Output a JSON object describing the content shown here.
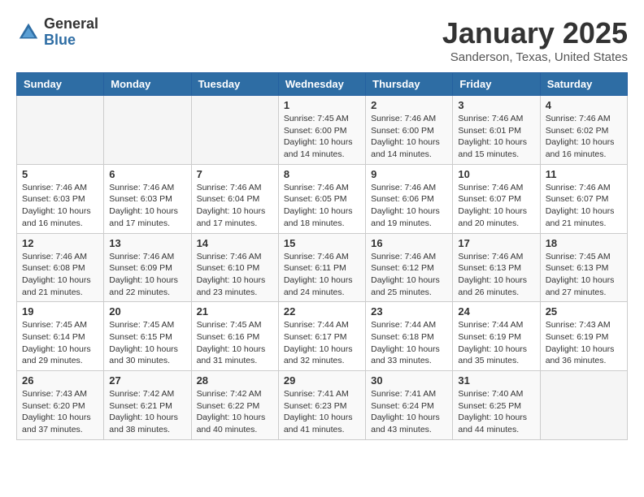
{
  "header": {
    "logo_general": "General",
    "logo_blue": "Blue",
    "title": "January 2025",
    "subtitle": "Sanderson, Texas, United States"
  },
  "days_of_week": [
    "Sunday",
    "Monday",
    "Tuesday",
    "Wednesday",
    "Thursday",
    "Friday",
    "Saturday"
  ],
  "weeks": [
    [
      {
        "day": "",
        "info": ""
      },
      {
        "day": "",
        "info": ""
      },
      {
        "day": "",
        "info": ""
      },
      {
        "day": "1",
        "info": "Sunrise: 7:45 AM\nSunset: 6:00 PM\nDaylight: 10 hours and 14 minutes."
      },
      {
        "day": "2",
        "info": "Sunrise: 7:46 AM\nSunset: 6:00 PM\nDaylight: 10 hours and 14 minutes."
      },
      {
        "day": "3",
        "info": "Sunrise: 7:46 AM\nSunset: 6:01 PM\nDaylight: 10 hours and 15 minutes."
      },
      {
        "day": "4",
        "info": "Sunrise: 7:46 AM\nSunset: 6:02 PM\nDaylight: 10 hours and 16 minutes."
      }
    ],
    [
      {
        "day": "5",
        "info": "Sunrise: 7:46 AM\nSunset: 6:03 PM\nDaylight: 10 hours and 16 minutes."
      },
      {
        "day": "6",
        "info": "Sunrise: 7:46 AM\nSunset: 6:03 PM\nDaylight: 10 hours and 17 minutes."
      },
      {
        "day": "7",
        "info": "Sunrise: 7:46 AM\nSunset: 6:04 PM\nDaylight: 10 hours and 17 minutes."
      },
      {
        "day": "8",
        "info": "Sunrise: 7:46 AM\nSunset: 6:05 PM\nDaylight: 10 hours and 18 minutes."
      },
      {
        "day": "9",
        "info": "Sunrise: 7:46 AM\nSunset: 6:06 PM\nDaylight: 10 hours and 19 minutes."
      },
      {
        "day": "10",
        "info": "Sunrise: 7:46 AM\nSunset: 6:07 PM\nDaylight: 10 hours and 20 minutes."
      },
      {
        "day": "11",
        "info": "Sunrise: 7:46 AM\nSunset: 6:07 PM\nDaylight: 10 hours and 21 minutes."
      }
    ],
    [
      {
        "day": "12",
        "info": "Sunrise: 7:46 AM\nSunset: 6:08 PM\nDaylight: 10 hours and 21 minutes."
      },
      {
        "day": "13",
        "info": "Sunrise: 7:46 AM\nSunset: 6:09 PM\nDaylight: 10 hours and 22 minutes."
      },
      {
        "day": "14",
        "info": "Sunrise: 7:46 AM\nSunset: 6:10 PM\nDaylight: 10 hours and 23 minutes."
      },
      {
        "day": "15",
        "info": "Sunrise: 7:46 AM\nSunset: 6:11 PM\nDaylight: 10 hours and 24 minutes."
      },
      {
        "day": "16",
        "info": "Sunrise: 7:46 AM\nSunset: 6:12 PM\nDaylight: 10 hours and 25 minutes."
      },
      {
        "day": "17",
        "info": "Sunrise: 7:46 AM\nSunset: 6:13 PM\nDaylight: 10 hours and 26 minutes."
      },
      {
        "day": "18",
        "info": "Sunrise: 7:45 AM\nSunset: 6:13 PM\nDaylight: 10 hours and 27 minutes."
      }
    ],
    [
      {
        "day": "19",
        "info": "Sunrise: 7:45 AM\nSunset: 6:14 PM\nDaylight: 10 hours and 29 minutes."
      },
      {
        "day": "20",
        "info": "Sunrise: 7:45 AM\nSunset: 6:15 PM\nDaylight: 10 hours and 30 minutes."
      },
      {
        "day": "21",
        "info": "Sunrise: 7:45 AM\nSunset: 6:16 PM\nDaylight: 10 hours and 31 minutes."
      },
      {
        "day": "22",
        "info": "Sunrise: 7:44 AM\nSunset: 6:17 PM\nDaylight: 10 hours and 32 minutes."
      },
      {
        "day": "23",
        "info": "Sunrise: 7:44 AM\nSunset: 6:18 PM\nDaylight: 10 hours and 33 minutes."
      },
      {
        "day": "24",
        "info": "Sunrise: 7:44 AM\nSunset: 6:19 PM\nDaylight: 10 hours and 35 minutes."
      },
      {
        "day": "25",
        "info": "Sunrise: 7:43 AM\nSunset: 6:19 PM\nDaylight: 10 hours and 36 minutes."
      }
    ],
    [
      {
        "day": "26",
        "info": "Sunrise: 7:43 AM\nSunset: 6:20 PM\nDaylight: 10 hours and 37 minutes."
      },
      {
        "day": "27",
        "info": "Sunrise: 7:42 AM\nSunset: 6:21 PM\nDaylight: 10 hours and 38 minutes."
      },
      {
        "day": "28",
        "info": "Sunrise: 7:42 AM\nSunset: 6:22 PM\nDaylight: 10 hours and 40 minutes."
      },
      {
        "day": "29",
        "info": "Sunrise: 7:41 AM\nSunset: 6:23 PM\nDaylight: 10 hours and 41 minutes."
      },
      {
        "day": "30",
        "info": "Sunrise: 7:41 AM\nSunset: 6:24 PM\nDaylight: 10 hours and 43 minutes."
      },
      {
        "day": "31",
        "info": "Sunrise: 7:40 AM\nSunset: 6:25 PM\nDaylight: 10 hours and 44 minutes."
      },
      {
        "day": "",
        "info": ""
      }
    ]
  ]
}
